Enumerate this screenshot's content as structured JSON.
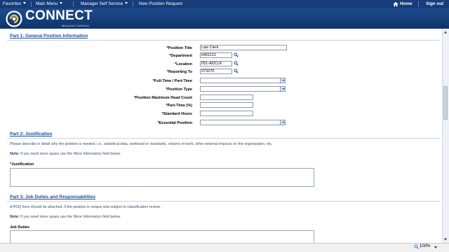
{
  "nav": {
    "favorites": "Favorites",
    "main_menu": "Main Menu",
    "manager_self_service": "Manager Self Service",
    "page_crumb": "New Position Request",
    "home": "Home",
    "sign_out": "Sign out"
  },
  "brand": {
    "name": "CONNECT",
    "subtitle": "Maryland Judiciary"
  },
  "part1": {
    "title": "Part 1: General Position Information",
    "fields": {
      "position_title": {
        "label": "*Position Title",
        "value": "Law Clerk"
      },
      "department": {
        "label": "*Department",
        "value": "0451121"
      },
      "location": {
        "label": "*Location",
        "value": "051-ADCLK"
      },
      "reporting_to": {
        "label": "*Reporting To",
        "value": "073270"
      },
      "full_part_time": {
        "label": "*Full-Time / Part-Time",
        "value": ""
      },
      "position_type": {
        "label": "*Position Type",
        "value": ""
      },
      "max_head_count": {
        "label": "*Position Maximum Head Count",
        "value": ""
      },
      "part_time_pct": {
        "label": "*Part-Time (%)",
        "value": ""
      },
      "standard_hours": {
        "label": "*Standard Hours",
        "value": ""
      },
      "essential_position": {
        "label": "*Essential Position",
        "value": ""
      }
    }
  },
  "part2": {
    "title": "Part 2: Justification",
    "description": "Please describe in detail why the position is needed, i.e., statistical data, workload or standards, volume of work, other external impacts on the organization, etc.",
    "note_label": "Note:",
    "note_text": " If you need more space use the More Information field below.",
    "justification_label": "*Justification"
  },
  "part3": {
    "title": "Part 3: Job Duties and Responsabilities",
    "description": "A PDQ form should be attached, if the position is unique and subject to classification review.",
    "note_label": "Note:",
    "note_text": " If you need more space use the More Information field below.",
    "job_duties_label": "Job Duties"
  },
  "status": {
    "zoom": "100%"
  },
  "colors": {
    "nav_bg": "#163d7a",
    "section_title": "#1a4c92"
  }
}
